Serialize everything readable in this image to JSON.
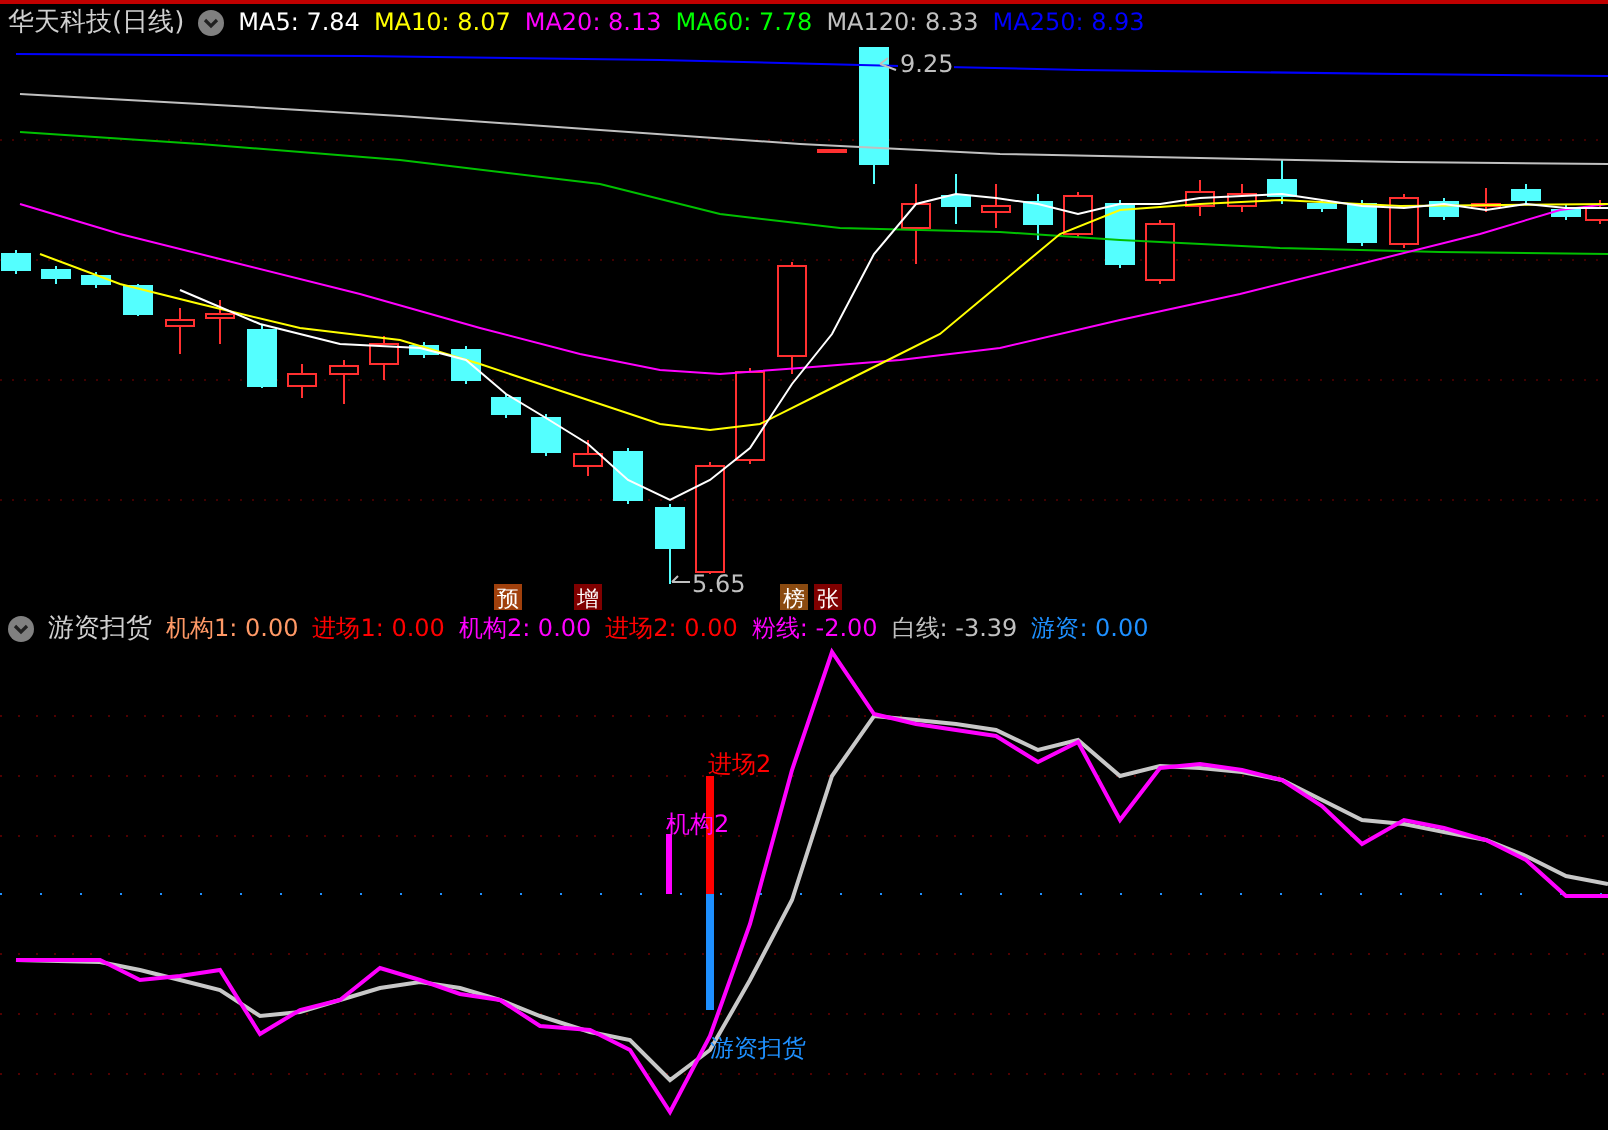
{
  "price_panel": {
    "title": "华天科技(日线)",
    "indicators": [
      {
        "text": "MA5: 7.84",
        "color": "#ffffff"
      },
      {
        "text": "MA10: 8.07",
        "color": "#ffff00"
      },
      {
        "text": "MA20: 8.13",
        "color": "#ff00ff"
      },
      {
        "text": "MA60: 7.78",
        "color": "#00ff00"
      },
      {
        "text": "MA120: 8.33",
        "color": "#c0c0c0"
      },
      {
        "text": "MA250: 8.93",
        "color": "#0000ff"
      }
    ],
    "high_label": "9.25",
    "low_label": "5.65",
    "signals": [
      {
        "text": "预",
        "color": "#a0400c"
      },
      {
        "text": "增",
        "color": "#800000"
      },
      {
        "text": "榜",
        "color": "#8a4a10"
      },
      {
        "text": "张",
        "color": "#800000"
      }
    ]
  },
  "indicator_panel": {
    "title": "游资扫货",
    "values": [
      {
        "text": "机构1: 0.00",
        "color": "#ff9966"
      },
      {
        "text": "进场1: 0.00",
        "color": "#ff0000"
      },
      {
        "text": "机构2: 0.00",
        "color": "#ff00ff"
      },
      {
        "text": "进场2: 0.00",
        "color": "#ff0000"
      },
      {
        "text": "粉线: -2.00",
        "color": "#ff00ff"
      },
      {
        "text": "白线: -3.39",
        "color": "#c0c0c0"
      },
      {
        "text": "游资: 0.00",
        "color": "#1e90ff"
      }
    ],
    "chart_labels": [
      {
        "text": "进场2",
        "color": "#ff0000"
      },
      {
        "text": "机构2",
        "color": "#ff00ff"
      },
      {
        "text": "游资扫货",
        "color": "#1e90ff"
      }
    ]
  }
}
